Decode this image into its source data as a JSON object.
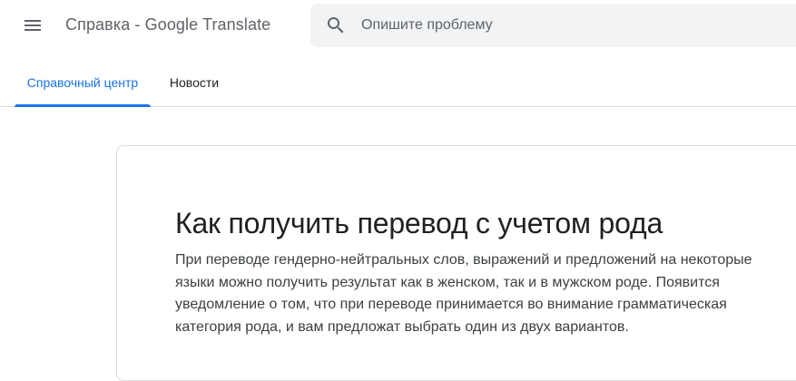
{
  "header": {
    "menu_icon": "hamburger-menu-icon",
    "product_title": "Справка - Google Translate",
    "search": {
      "icon": "search-icon",
      "placeholder": "Опишите проблему",
      "value": ""
    }
  },
  "tabs": [
    {
      "label": "Справочный центр",
      "active": true
    },
    {
      "label": "Новости",
      "active": false
    }
  ],
  "article": {
    "title": "Как получить перевод с учетом рода",
    "body": "При переводе гендерно-нейтральных слов, выражений и предложений на некоторые языки можно получить результат как в женском, так и в мужском роде. Появится уведомление о том, что при переводе принимается во внимание грамматическая категория рода, и вам предложат выбрать один из двух вариантов."
  },
  "colors": {
    "accent": "#1a73e8",
    "search_bg": "#f1f3f4",
    "border": "#dadce0",
    "text_secondary": "#5f6368"
  }
}
